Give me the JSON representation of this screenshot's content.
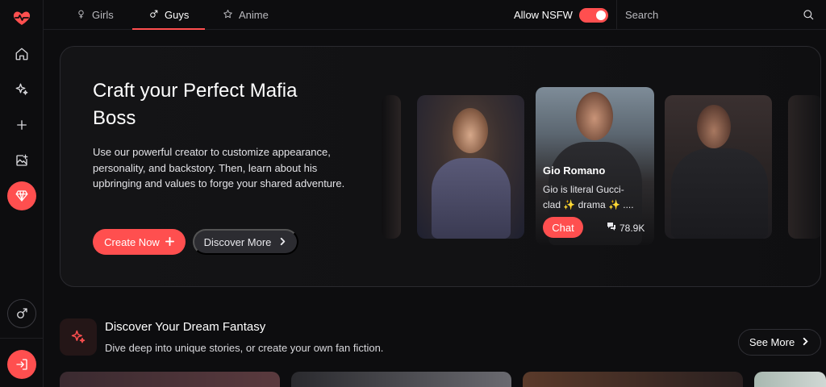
{
  "topbar": {
    "tabs": [
      {
        "label": "Girls",
        "icon": "female-icon"
      },
      {
        "label": "Guys",
        "icon": "male-icon"
      },
      {
        "label": "Anime",
        "icon": "star-icon"
      }
    ],
    "active_tab": "Guys",
    "nsfw_label": "Allow NSFW",
    "nsfw_enabled": true,
    "search_placeholder": "Search"
  },
  "sidebar": {
    "items": [
      "logo-heart-icon",
      "home-icon",
      "sparkles-icon",
      "plus-icon",
      "image-add-icon",
      "diamond-icon",
      "male-icon",
      "login-icon"
    ]
  },
  "hero": {
    "title": "Craft your Perfect Mafia Boss",
    "description": "Use our powerful creator to customize appearance, personality, and backstory. Then, learn about his upbringing and values to forge your shared adventure.",
    "create_button": "Create Now",
    "discover_button": "Discover More",
    "featured": {
      "name": "Gio Romano",
      "description": "Gio is literal Gucci-clad ✨ drama ✨ ....",
      "chat_button": "Chat",
      "chat_count": "78.9K"
    }
  },
  "section": {
    "title": "Discover Your Dream Fantasy",
    "subtitle": "Dive deep into unique stories, or create your own fan fiction.",
    "see_more": "See More"
  },
  "colors": {
    "accent": "#ff4f4f",
    "background": "#0d0d0f"
  }
}
